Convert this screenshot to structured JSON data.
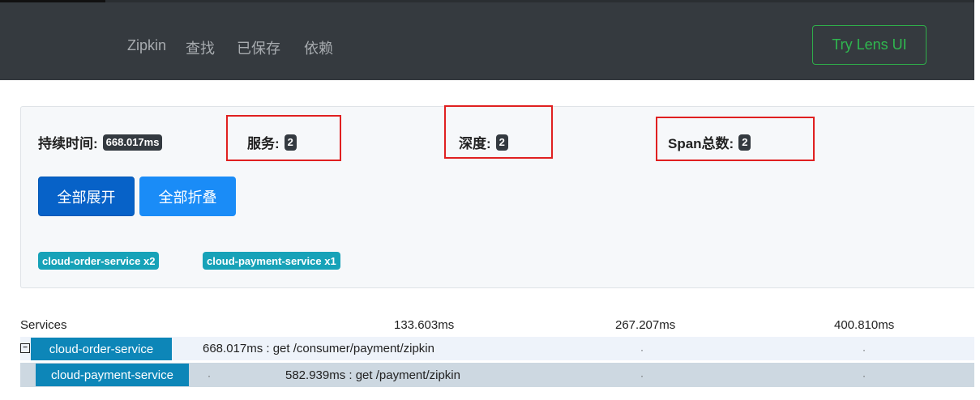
{
  "navbar": {
    "brand": "Zipkin",
    "links": [
      "查找",
      "已保存",
      "依赖"
    ],
    "lens_button": "Try Lens UI"
  },
  "summary": {
    "duration_label": "持续时间:",
    "duration_value": "668.017ms",
    "services_label": "服务:",
    "services_value": "2",
    "depth_label": "深度:",
    "depth_value": "2",
    "span_total_label": "Span总数:",
    "span_total_value": "2"
  },
  "buttons": {
    "expand_all": "全部展开",
    "collapse_all": "全部折叠"
  },
  "service_tags": [
    "cloud-order-service x2",
    "cloud-payment-service x1"
  ],
  "timeline": {
    "header": "Services",
    "ticks": [
      "133.603ms",
      "267.207ms",
      "400.810ms"
    ],
    "toggle_symbol": "−",
    "rows": [
      {
        "service": "cloud-order-service",
        "span": "668.017ms : get /consumer/payment/zipkin"
      },
      {
        "service": "cloud-payment-service",
        "span": "582.939ms : get /payment/zipkin"
      }
    ],
    "dot": "·"
  },
  "colors": {
    "navbar_bg": "#353a3f",
    "lens_green": "#2fb84f",
    "expand_blue": "#0762c8",
    "collapse_blue": "#1a8cf7",
    "tag_teal": "#17a2b8",
    "chip_blue": "#0d86b8",
    "highlight_red": "#e02020"
  }
}
